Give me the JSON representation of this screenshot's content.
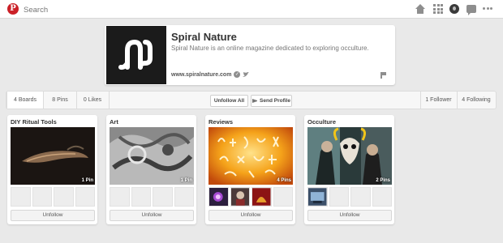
{
  "topbar": {
    "logo": "P",
    "search_placeholder": "Search"
  },
  "profile": {
    "name": "Spiral Nature",
    "description": "Spiral Nature is an online magazine dedicated to exploring occulture.",
    "website": "www.spiralnature.com",
    "verified_glyph": "✓",
    "twitter_glyph": "🐦"
  },
  "stats": {
    "boards": "4 Boards",
    "pins": "8 Pins",
    "likes": "0 Likes",
    "unfollow_all": "Unfollow All",
    "send_profile": "Send Profile",
    "followers": "1 Follower",
    "following": "4 Following"
  },
  "boards": [
    {
      "title": "DIY Ritual Tools",
      "pins": "1 Pin",
      "button": "Unfollow"
    },
    {
      "title": "Art",
      "pins": "1 Pin",
      "button": "Unfollow"
    },
    {
      "title": "Reviews",
      "pins": "4 Pins",
      "button": "Unfollow"
    },
    {
      "title": "Occulture",
      "pins": "2 Pins",
      "button": "Unfollow"
    }
  ],
  "icons": {
    "logo": "pinterest-logo-icon",
    "home": "home-icon",
    "apps": "grid-icon",
    "profile": "avatar-icon",
    "messages": "message-icon",
    "more": "more-icon",
    "report": "flag-icon"
  },
  "colors": {
    "brand": "#cb2027",
    "background": "#e9e9e9"
  }
}
